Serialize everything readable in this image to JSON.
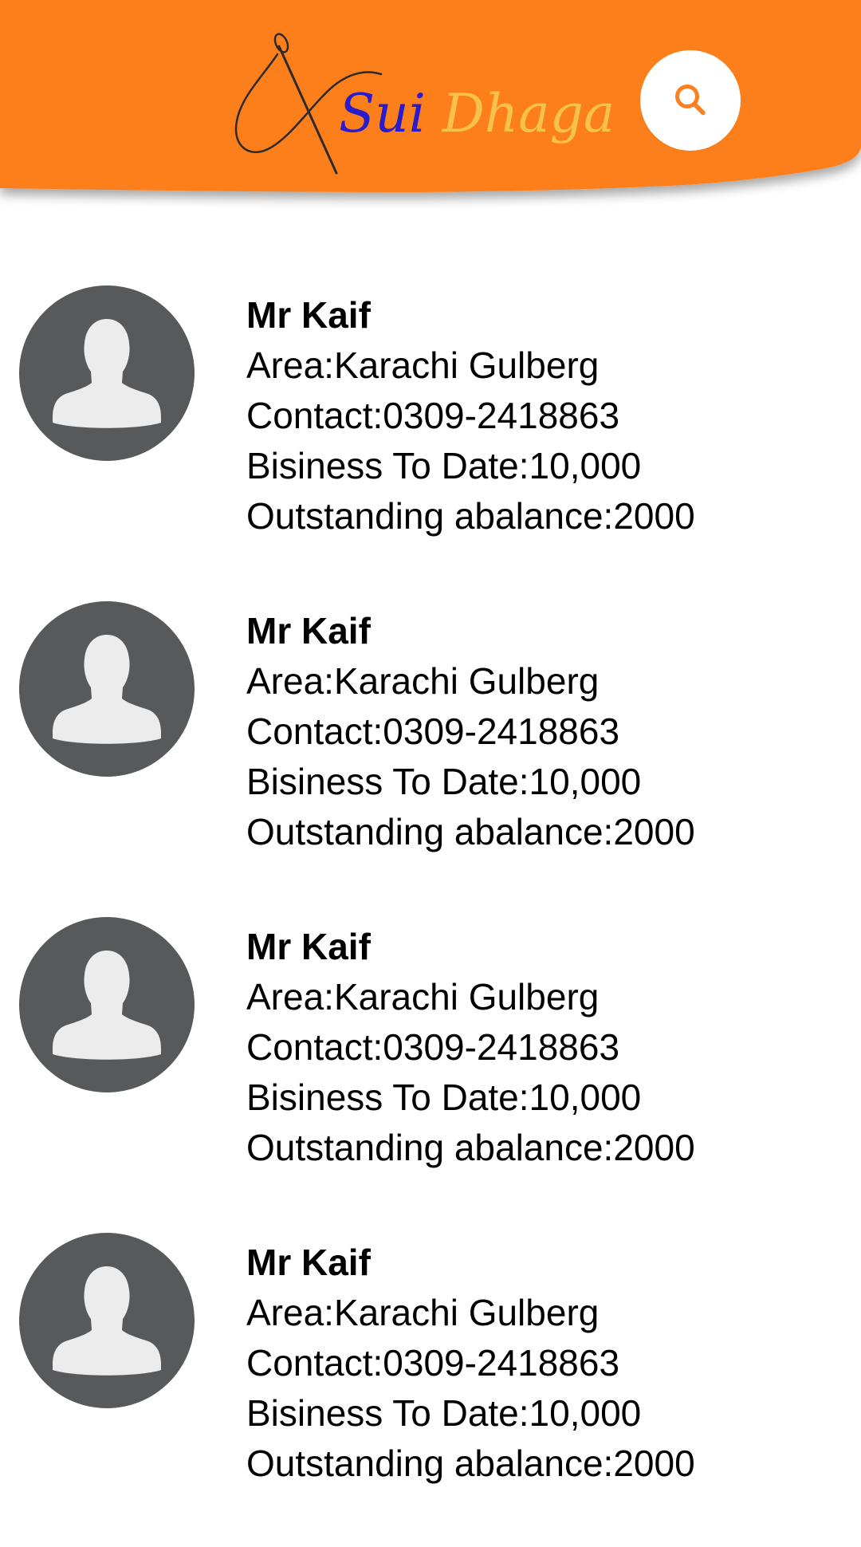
{
  "header": {
    "background_color": "#fd7f1d",
    "logo": {
      "word1": "Sui",
      "word2": "Dhaga",
      "word1_color": "#2a1ccb",
      "word2_color": "#f7c24a",
      "mark_icon": "needle-and-thread-icon"
    },
    "search_icon": "search-icon",
    "search_icon_color": "#fd7f1d"
  },
  "customers": [
    {
      "name": "Mr Kaif",
      "area": "Area:Karachi Gulberg",
      "contact": "Contact:0309-2418863",
      "business": "Bisiness To Date:10,000",
      "outstanding": "Outstanding abalance:2000"
    },
    {
      "name": "Mr Kaif",
      "area": "Area:Karachi Gulberg",
      "contact": "Contact:0309-2418863",
      "business": "Bisiness To Date:10,000",
      "outstanding": "Outstanding abalance:2000"
    },
    {
      "name": "Mr Kaif",
      "area": "Area:Karachi Gulberg",
      "contact": "Contact:0309-2418863",
      "business": "Bisiness To Date:10,000",
      "outstanding": "Outstanding abalance:2000"
    },
    {
      "name": "Mr Kaif",
      "area": "Area:Karachi Gulberg",
      "contact": "Contact:0309-2418863",
      "business": "Bisiness To Date:10,000",
      "outstanding": "Outstanding abalance:2000"
    }
  ],
  "avatar_icon": "user-silhouette-icon",
  "avatar_color": "#58595b"
}
